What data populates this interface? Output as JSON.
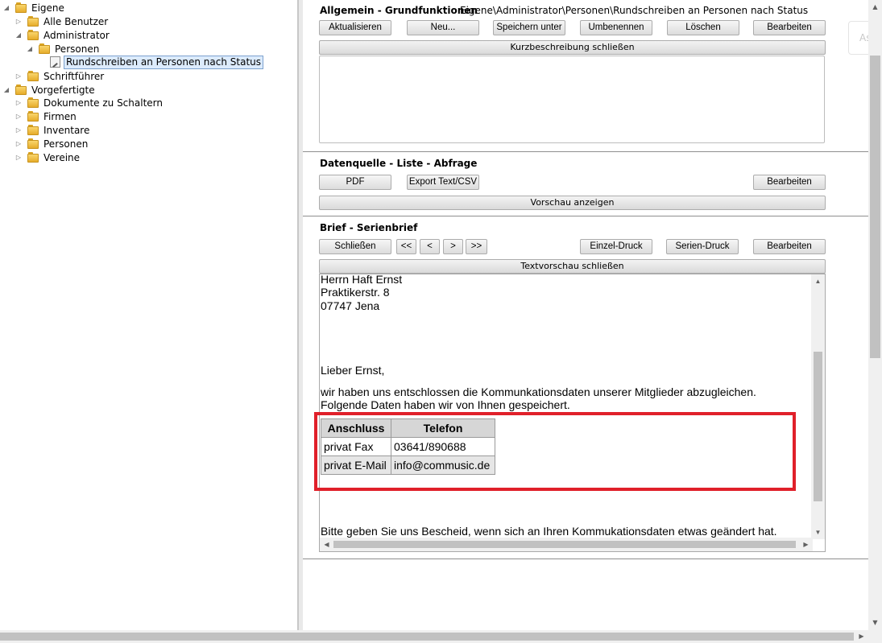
{
  "tree": {
    "nodes": [
      {
        "label": "Eigene",
        "expanded": true
      },
      {
        "label": "Alle Benutzer",
        "expanded": false
      },
      {
        "label": "Administrator",
        "expanded": true
      },
      {
        "label": "Personen",
        "expanded": true
      },
      {
        "label": "Rundschreiben an Personen nach Status",
        "selected": true
      },
      {
        "label": "Schriftführer",
        "expanded": false
      },
      {
        "label": "Vorgefertigte",
        "expanded": true
      },
      {
        "label": "Dokumente zu Schaltern",
        "expanded": false
      },
      {
        "label": "Firmen",
        "expanded": false
      },
      {
        "label": "Inventare",
        "expanded": false
      },
      {
        "label": "Personen",
        "expanded": false
      },
      {
        "label": "Vereine",
        "expanded": false
      }
    ]
  },
  "general": {
    "title": "Allgemein - Grundfunktionen",
    "path": "Eigene\\Administrator\\Personen\\Rundschreiben an Personen nach Status",
    "buttons": {
      "refresh": "Aktualisieren",
      "new": "Neu...",
      "save_as": "Speichern unter",
      "rename": "Umbenennen",
      "delete": "Löschen",
      "edit": "Bearbeiten"
    },
    "description_bar": "Kurzbeschreibung schließen"
  },
  "datasource": {
    "title": "Datenquelle - Liste - Abfrage",
    "buttons": {
      "pdf": "PDF",
      "export": "Export Text/CSV",
      "edit": "Bearbeiten"
    },
    "preview_bar": "Vorschau anzeigen"
  },
  "letter": {
    "title": "Brief - Serienbrief",
    "buttons": {
      "close": "Schließen",
      "first": "<<",
      "prev": "<",
      "next": ">",
      "last": ">>",
      "single_print": "Einzel-Druck",
      "serial_print": "Serien-Druck",
      "edit": "Bearbeiten"
    },
    "preview_bar": "Textvorschau schließen",
    "body": {
      "address_line1": "Herrn Haft Ernst",
      "address_line2": "Praktikerstr. 8",
      "address_line3": "07747 Jena",
      "salutation": "Lieber Ernst,",
      "para1_line1": "wir haben uns entschlossen die Kommunkationsdaten unserer Mitglieder abzugleichen.",
      "para1_line2": "Folgende Daten haben wir von Ihnen gespeichert.",
      "table_headers": [
        "Anschluss",
        "Telefon"
      ],
      "table_rows": [
        [
          "privat Fax",
          "03641/890688"
        ],
        [
          "privat E-Mail",
          "info@commusic.de"
        ]
      ],
      "closing": "Bitte geben Sie uns Bescheid, wenn sich an Ihren Kommukationsdaten etwas geändert hat."
    }
  },
  "ghost_panel_text": "As",
  "colors": {
    "highlight_border": "#e0202a",
    "selection_bg": "#dcebfc",
    "folder": "#e6ac2a"
  }
}
